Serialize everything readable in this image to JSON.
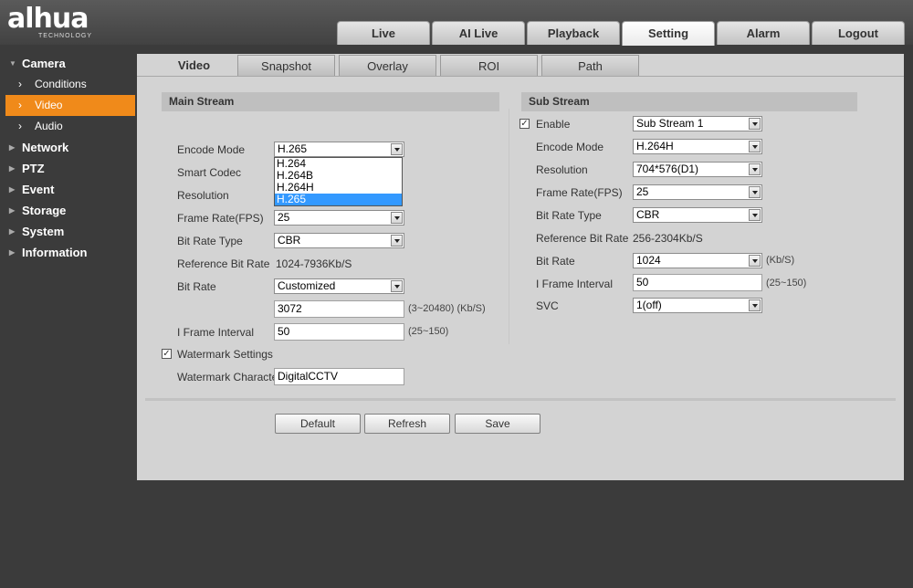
{
  "brand": {
    "logo": "alhua",
    "sub": "TECHNOLOGY"
  },
  "main_tabs": [
    "Live",
    "AI Live",
    "Playback",
    "Setting",
    "Alarm",
    "Logout"
  ],
  "active_main_tab": "Setting",
  "sidebar": {
    "camera": "Camera",
    "camera_items": [
      "Conditions",
      "Video",
      "Audio"
    ],
    "active_item": "Video",
    "groups": [
      "Network",
      "PTZ",
      "Event",
      "Storage",
      "System",
      "Information"
    ]
  },
  "sub_tabs": [
    "Video",
    "Snapshot",
    "Overlay",
    "ROI",
    "Path"
  ],
  "active_sub_tab": "Video",
  "main_stream": {
    "title": "Main Stream",
    "encode_mode_label": "Encode Mode",
    "encode_mode": "H.265",
    "encode_options": [
      "H.264",
      "H.264B",
      "H.264H",
      "H.265"
    ],
    "encode_selected": "H.265",
    "smart_codec_label": "Smart Codec",
    "resolution_label": "Resolution",
    "frame_rate_label": "Frame Rate(FPS)",
    "frame_rate": "25",
    "bit_rate_type_label": "Bit Rate Type",
    "bit_rate_type": "CBR",
    "ref_bit_rate_label": "Reference Bit Rate",
    "ref_bit_rate": "1024-7936Kb/S",
    "bit_rate_label": "Bit Rate",
    "bit_rate": "Customized",
    "custom_bit_rate": "3072",
    "custom_bit_rate_hint": "(3~20480) (Kb/S)",
    "iframe_label": "I Frame Interval",
    "iframe": "50",
    "iframe_hint": "(25~150)",
    "watermark_settings_label": "Watermark Settings",
    "watermark_checked": true,
    "watermark_char_label": "Watermark Character",
    "watermark_char": "DigitalCCTV"
  },
  "sub_stream": {
    "title": "Sub Stream",
    "enable_label": "Enable",
    "enable_checked": true,
    "stream": "Sub Stream 1",
    "encode_mode_label": "Encode Mode",
    "encode_mode": "H.264H",
    "resolution_label": "Resolution",
    "resolution": "704*576(D1)",
    "frame_rate_label": "Frame Rate(FPS)",
    "frame_rate": "25",
    "bit_rate_type_label": "Bit Rate Type",
    "bit_rate_type": "CBR",
    "ref_bit_rate_label": "Reference Bit Rate",
    "ref_bit_rate": "256-2304Kb/S",
    "bit_rate_label": "Bit Rate",
    "bit_rate": "1024",
    "bit_rate_unit": "(Kb/S)",
    "iframe_label": "I Frame Interval",
    "iframe": "50",
    "iframe_hint": "(25~150)",
    "svc_label": "SVC",
    "svc": "1(off)"
  },
  "buttons": {
    "default": "Default",
    "refresh": "Refresh",
    "save": "Save"
  },
  "colors": {
    "accent": "#f08a1a",
    "highlight": "#3399ff"
  }
}
